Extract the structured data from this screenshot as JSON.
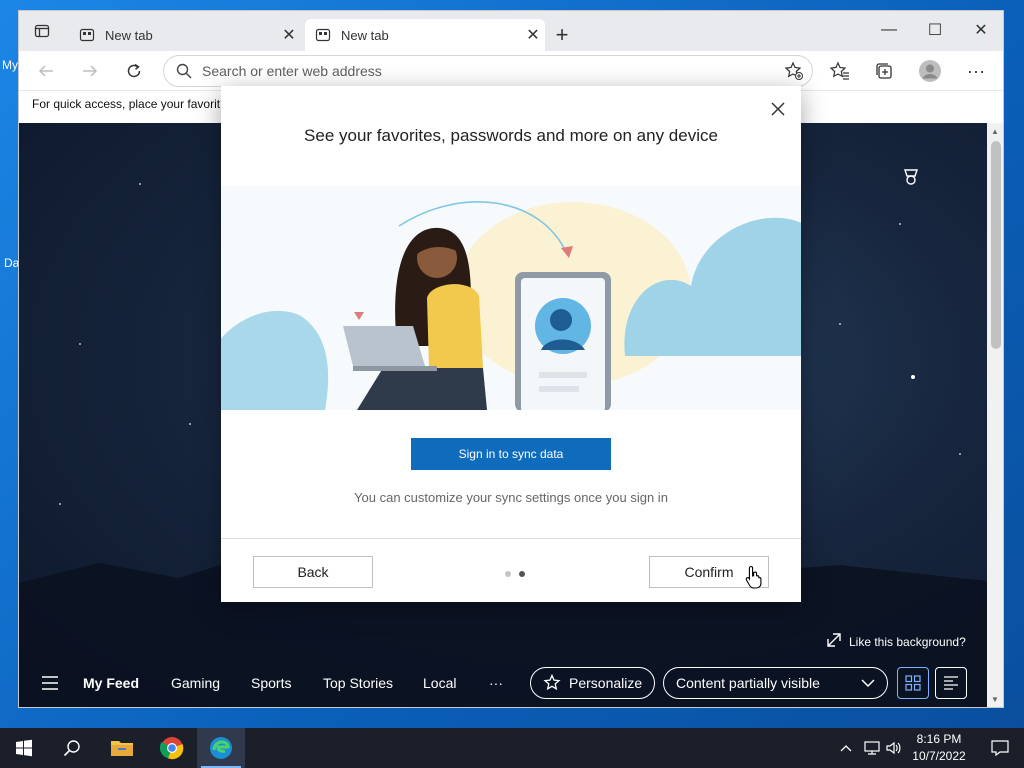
{
  "desktop": {
    "label_top": "My",
    "label_bottom": "Da"
  },
  "tabs": [
    {
      "label": "New tab",
      "close": "✕"
    },
    {
      "label": "New tab",
      "close": "✕"
    }
  ],
  "new_tab_symbol": "+",
  "window_controls": {
    "minimize": "—",
    "maximize": "☐",
    "close": "✕"
  },
  "address_bar": {
    "placeholder": "Search or enter web address"
  },
  "favorites_bar": {
    "text": "For quick access, place your favorit"
  },
  "dialog": {
    "title": "See your favorites, passwords and more on any device",
    "primary_button": "Sign in to sync data",
    "subtitle": "You can customize your sync settings once you sign in",
    "back_button": "Back",
    "confirm_button": "Confirm",
    "page_indicator": {
      "current": 2,
      "total": 2
    }
  },
  "page": {
    "like_background": "Like this background?",
    "feed_tabs": [
      "My Feed",
      "Gaming",
      "Sports",
      "Top Stories",
      "Local"
    ],
    "more": "···",
    "personalize": "Personalize",
    "content_visibility": "Content partially visible"
  },
  "taskbar": {
    "time": "8:16 PM",
    "date": "10/7/2022"
  },
  "colors": {
    "accent": "#0f6cbd",
    "taskbar": "#1a1f2a",
    "desktop": "#0a5fb8"
  },
  "icons": [
    "windows-start-icon",
    "search-icon",
    "file-explorer-icon",
    "chrome-icon",
    "edge-icon",
    "chevron-up-icon",
    "network-icon",
    "volume-icon",
    "notification-icon"
  ]
}
